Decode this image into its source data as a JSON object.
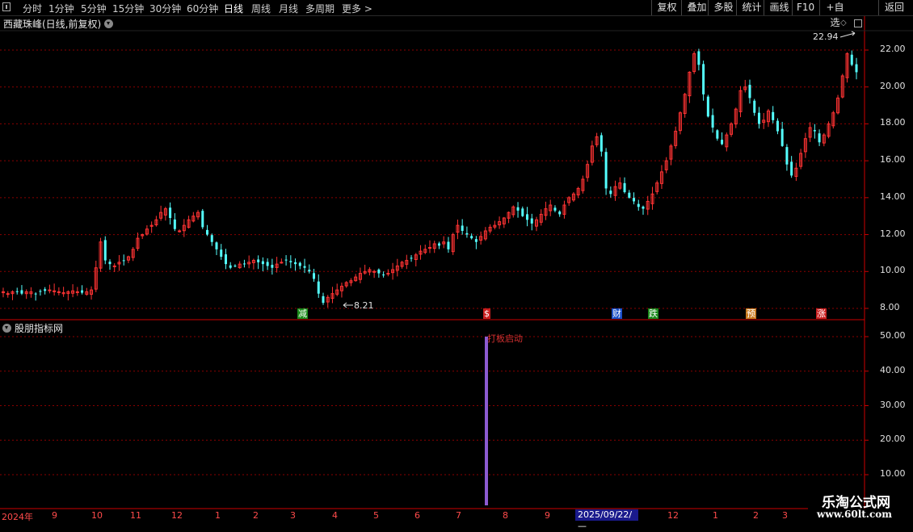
{
  "toolbar": {
    "periods": [
      "分时",
      "1分钟",
      "5分钟",
      "15分钟",
      "30分钟",
      "60分钟",
      "日线",
      "周线",
      "月线",
      "多周期",
      "更多 >"
    ],
    "active_period": "日线",
    "right_buttons": [
      "复权",
      "叠加",
      "多股",
      "统计",
      "画线",
      "F10",
      "+自选",
      "返回"
    ]
  },
  "main_chart": {
    "title": "西藏珠峰(日线,前复权)",
    "high_label": "22.94",
    "low_label": "8.21",
    "y_ticks": [
      "22.00",
      "20.00",
      "18.00",
      "16.00",
      "14.00",
      "12.00",
      "10.00",
      "8.00"
    ],
    "badges": [
      {
        "text": "减",
        "color": "#1a8a1a"
      },
      {
        "text": "$",
        "color": "#c81e1e"
      },
      {
        "text": "财",
        "color": "#1a4fc8"
      },
      {
        "text": "跌",
        "color": "#1a8a1a"
      },
      {
        "text": "预",
        "color": "#c87a1e"
      },
      {
        "text": "涨",
        "color": "#c81e1e"
      }
    ]
  },
  "sub_chart": {
    "title": "股朋指标网",
    "y_ticks": [
      "50.00",
      "40.00",
      "30.00",
      "20.00",
      "10.00"
    ],
    "signal_label": "打板启动",
    "signal_value": 50
  },
  "date_axis": {
    "labels": [
      "2024年",
      "9",
      "10",
      "11",
      "12",
      "1",
      "2",
      "3",
      "4",
      "5",
      "6",
      "7",
      "8",
      "9",
      "12",
      "1",
      "2",
      "3"
    ],
    "selected": "2025/09/22/—"
  },
  "watermark": {
    "line1": "乐淘公式网",
    "line2": "www.60lt.com"
  },
  "colors": {
    "up": "#ff3333",
    "down": "#54ffff",
    "grid": "#8b0000",
    "signal_bar": "#8c5ad0"
  },
  "chart_data": {
    "type": "candlestick",
    "title": "西藏珠峰(日线,前复权)",
    "ylim": [
      7.5,
      23.5
    ],
    "close_path": [
      8.9,
      8.8,
      8.9,
      8.9,
      8.8,
      8.9,
      8.9,
      8.8,
      8.9,
      8.95,
      9.0,
      8.95,
      8.9,
      8.85,
      8.9,
      8.95,
      8.9,
      8.85,
      8.9,
      9.0,
      10.2,
      11.6,
      10.6,
      10.4,
      10.3,
      10.5,
      10.6,
      10.8,
      11.2,
      11.8,
      12.0,
      12.3,
      12.5,
      12.8,
      13.2,
      13.4,
      12.9,
      12.3,
      12.2,
      12.5,
      12.8,
      13.0,
      13.2,
      12.4,
      12.0,
      11.6,
      11.2,
      10.8,
      10.4,
      10.2,
      10.3,
      10.4,
      10.4,
      10.5,
      10.6,
      10.5,
      10.4,
      10.3,
      10.2,
      10.4,
      10.5,
      10.6,
      10.5,
      10.4,
      10.3,
      10.2,
      10.0,
      9.6,
      8.8,
      8.3,
      8.6,
      8.8,
      9.0,
      9.2,
      9.4,
      9.5,
      9.7,
      9.9,
      10.0,
      10.1,
      10.0,
      9.9,
      9.8,
      9.9,
      10.1,
      10.3,
      10.5,
      10.6,
      10.7,
      10.9,
      11.1,
      11.2,
      11.3,
      11.5,
      11.4,
      11.6,
      11.2,
      12.0,
      12.5,
      12.2,
      12.0,
      11.8,
      11.6,
      11.9,
      12.2,
      12.4,
      12.5,
      12.7,
      12.9,
      13.2,
      13.5,
      13.3,
      13.0,
      12.8,
      12.6,
      12.8,
      13.1,
      13.4,
      13.6,
      13.3,
      13.1,
      13.6,
      14.0,
      14.2,
      14.5,
      15.0,
      15.8,
      16.8,
      17.3,
      16.5,
      14.5,
      14.2,
      14.6,
      14.8,
      14.3,
      14.0,
      13.8,
      13.5,
      13.4,
      13.8,
      14.2,
      14.8,
      15.4,
      16.0,
      16.8,
      17.6,
      18.6,
      19.6,
      20.8,
      21.8,
      21.2,
      19.6,
      18.4,
      17.8,
      17.2,
      16.9,
      17.4,
      18.0,
      18.8,
      19.8,
      20.0,
      19.4,
      18.6,
      18.0,
      18.2,
      18.7,
      18.2,
      17.6,
      16.8,
      15.8,
      15.2,
      15.6,
      16.4,
      17.2,
      17.8,
      17.6,
      17.0,
      17.4,
      18.0,
      18.6,
      19.4,
      20.6,
      21.8,
      21.2,
      20.8
    ]
  }
}
